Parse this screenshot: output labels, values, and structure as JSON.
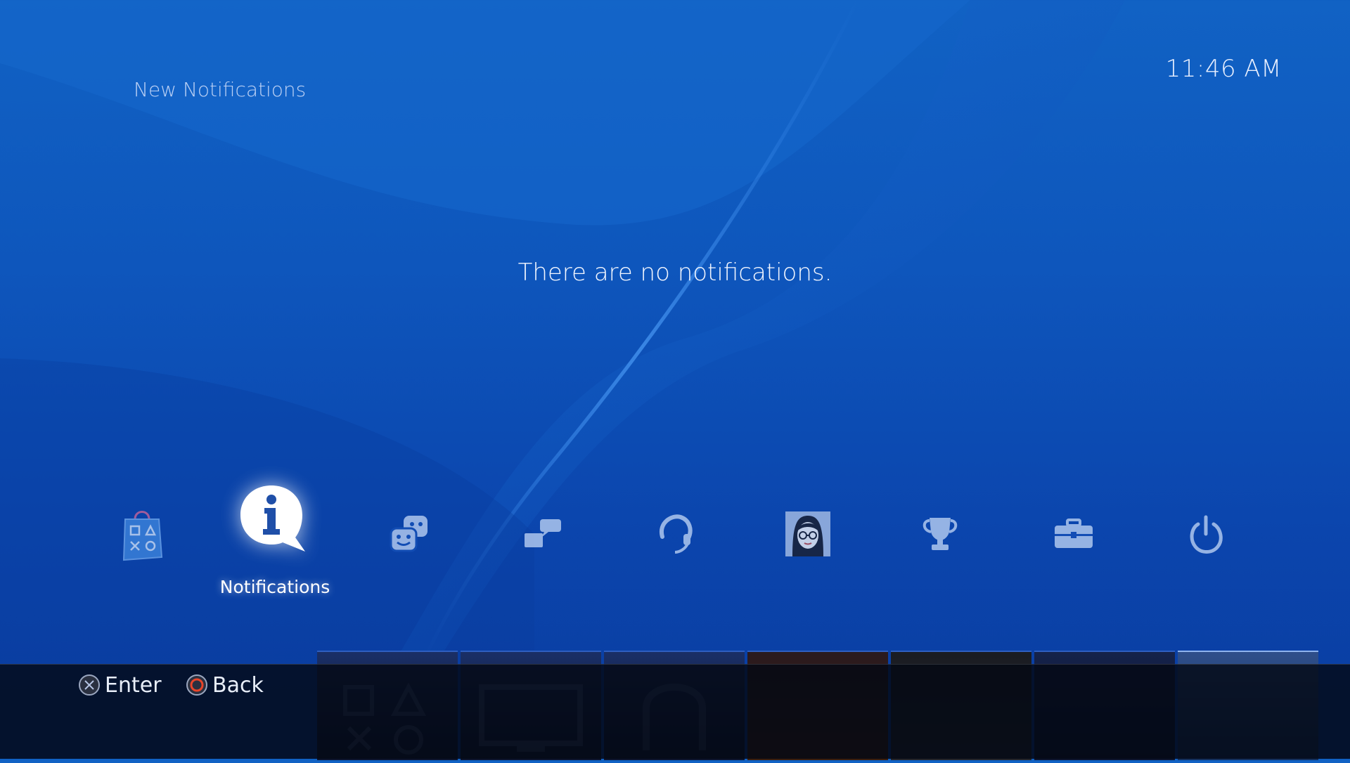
{
  "clock": "11:46 AM",
  "section_title": "New Notifications",
  "empty_message": "There are no notifications.",
  "function_bar": {
    "items": [
      {
        "name": "playstation-store",
        "label": ""
      },
      {
        "name": "notifications",
        "label": "Notifications",
        "selected": true
      },
      {
        "name": "friends",
        "label": ""
      },
      {
        "name": "messages",
        "label": ""
      },
      {
        "name": "party",
        "label": ""
      },
      {
        "name": "profile",
        "label": ""
      },
      {
        "name": "trophies",
        "label": ""
      },
      {
        "name": "settings",
        "label": ""
      },
      {
        "name": "power",
        "label": ""
      }
    ]
  },
  "hints": {
    "enter": {
      "button": "cross-icon",
      "label": "Enter"
    },
    "back": {
      "button": "circle-icon",
      "label": "Back"
    }
  },
  "colors": {
    "background": "#0e56bc",
    "accent": "#ffffff",
    "circle_button": "#e8452a",
    "bottom_bar": "#04081a"
  }
}
